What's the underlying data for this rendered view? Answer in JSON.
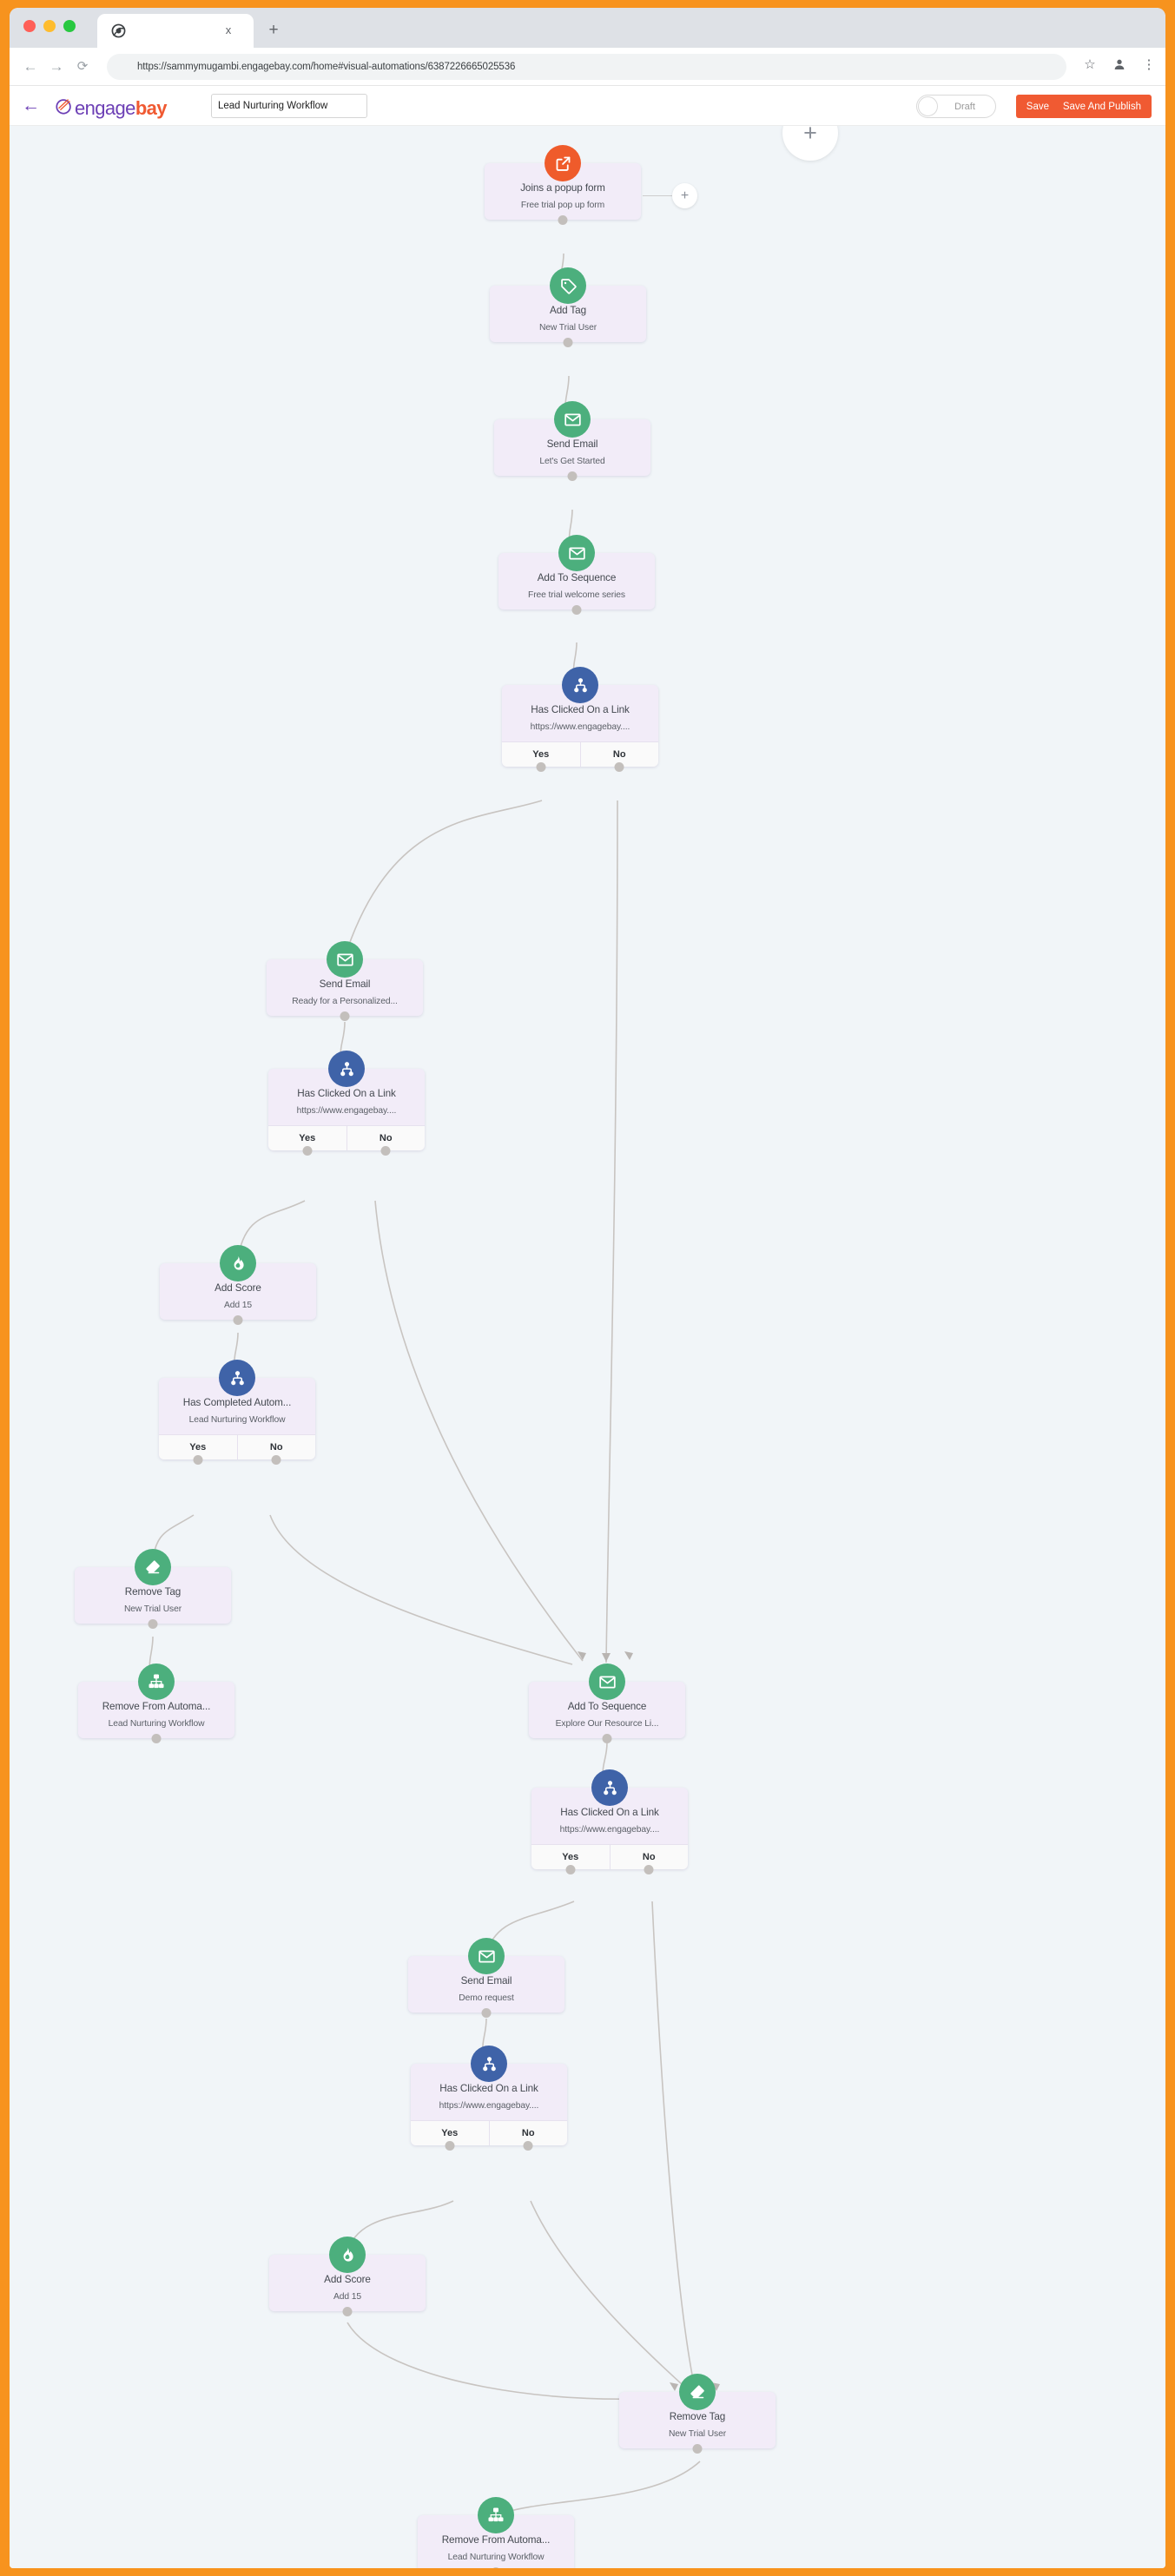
{
  "browser": {
    "tab": {
      "favicon": "chrome-icon",
      "close_label": "x",
      "newtab_label": "+"
    },
    "nav": {
      "back": "←",
      "forward": "→",
      "reload": "⟳"
    },
    "url": "https://sammymugambi.engagebay.com/home#visual-automations/6387226665025536",
    "bookmark_icon": "☆",
    "profile_icon": "●",
    "menu_icon": "⋮"
  },
  "appbar": {
    "back_label": "←",
    "logo_engage": "engage",
    "logo_bay": "bay",
    "workflow_name": "Lead Nurturing Workflow",
    "status_label": "Draft",
    "save_label": "Save",
    "publish_label": "Save And Publish"
  },
  "canvas": {
    "add_node_label": "+",
    "trigger_add_label": "+"
  },
  "nodes": [
    {
      "id": "trigger",
      "title": "Joins a popup form",
      "sub": "Free trial pop up form",
      "icon": "external-link-icon",
      "color": "orange",
      "branches": []
    },
    {
      "id": "add_tag",
      "title": "Add Tag",
      "sub": "New Trial User",
      "icon": "tag-icon",
      "color": "green",
      "branches": []
    },
    {
      "id": "send_email_1",
      "title": "Send Email",
      "sub": "Let's Get Started",
      "icon": "envelope-icon",
      "color": "green",
      "branches": []
    },
    {
      "id": "seq_1",
      "title": "Add To Sequence",
      "sub": "Free trial welcome series",
      "icon": "envelope-icon",
      "color": "green",
      "branches": []
    },
    {
      "id": "cond_1",
      "title": "Has Clicked On a Link",
      "sub": "https://www.engagebay....",
      "icon": "condition-icon",
      "color": "blue",
      "branches": [
        "Yes",
        "No"
      ]
    },
    {
      "id": "send_email_2",
      "title": "Send Email",
      "sub": "Ready for a Personalized...",
      "icon": "envelope-icon",
      "color": "green",
      "branches": []
    },
    {
      "id": "cond_2",
      "title": "Has Clicked On a Link",
      "sub": "https://www.engagebay....",
      "icon": "condition-icon",
      "color": "blue",
      "branches": [
        "Yes",
        "No"
      ]
    },
    {
      "id": "score_1",
      "title": "Add Score",
      "sub": "Add 15",
      "icon": "score-flame-icon",
      "color": "green",
      "branches": []
    },
    {
      "id": "cond_3",
      "title": "Has Completed Autom...",
      "sub": "Lead Nurturing Workflow",
      "icon": "condition-icon",
      "color": "blue",
      "branches": [
        "Yes",
        "No"
      ]
    },
    {
      "id": "rm_tag_1",
      "title": "Remove Tag",
      "sub": "New Trial User",
      "icon": "eraser-icon",
      "color": "green",
      "branches": []
    },
    {
      "id": "rm_auto_1",
      "title": "Remove From Automa...",
      "sub": "Lead Nurturing Workflow",
      "icon": "hierarchy-icon",
      "color": "green",
      "branches": []
    },
    {
      "id": "seq_2",
      "title": "Add To Sequence",
      "sub": "Explore Our Resource Li...",
      "icon": "envelope-icon",
      "color": "green",
      "branches": []
    },
    {
      "id": "cond_4",
      "title": "Has Clicked On a Link",
      "sub": "https://www.engagebay....",
      "icon": "condition-icon",
      "color": "blue",
      "branches": [
        "Yes",
        "No"
      ]
    },
    {
      "id": "send_email_3",
      "title": "Send Email",
      "sub": "Demo request",
      "icon": "envelope-icon",
      "color": "green",
      "branches": []
    },
    {
      "id": "cond_5",
      "title": "Has Clicked On a Link",
      "sub": "https://www.engagebay....",
      "icon": "condition-icon",
      "color": "blue",
      "branches": [
        "Yes",
        "No"
      ]
    },
    {
      "id": "score_2",
      "title": "Add Score",
      "sub": "Add 15",
      "icon": "score-flame-icon",
      "color": "green",
      "branches": []
    },
    {
      "id": "rm_tag_2",
      "title": "Remove Tag",
      "sub": "New Trial User",
      "icon": "eraser-icon",
      "color": "green",
      "branches": []
    },
    {
      "id": "rm_auto_2",
      "title": "Remove From Automa...",
      "sub": "Lead Nurturing Workflow",
      "icon": "hierarchy-icon",
      "color": "green",
      "branches": []
    }
  ],
  "colors": {
    "accent_orange": "#f05a32",
    "brand_purple": "#6c3fb5",
    "node_bg": "#f2ecf8",
    "icon_green": "#4caf7d",
    "icon_blue": "#3f63a8",
    "icon_orange": "#ef5b2b",
    "canvas_bg": "#f1f5f8",
    "window_border": "#f7931e"
  }
}
